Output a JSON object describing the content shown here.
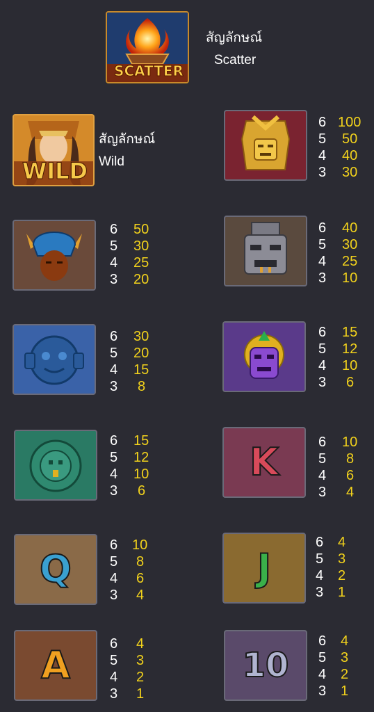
{
  "scatter": {
    "label_th": "สัญลักษณ์",
    "label_en": "Scatter",
    "badge": "SCATTER"
  },
  "wild": {
    "label_th": "สัญลักษณ์",
    "label_en": "Wild",
    "badge": "WILD"
  },
  "paytable": [
    {
      "symbol": "gold-mask-icon",
      "rows": [
        {
          "count": "6",
          "mult": "100"
        },
        {
          "count": "5",
          "mult": "50"
        },
        {
          "count": "4",
          "mult": "40"
        },
        {
          "count": "3",
          "mult": "30"
        }
      ]
    },
    {
      "symbol": "blue-headdress-icon",
      "rows": [
        {
          "count": "6",
          "mult": "50"
        },
        {
          "count": "5",
          "mult": "30"
        },
        {
          "count": "4",
          "mult": "25"
        },
        {
          "count": "3",
          "mult": "20"
        }
      ]
    },
    {
      "symbol": "stone-mask-icon",
      "rows": [
        {
          "count": "6",
          "mult": "40"
        },
        {
          "count": "5",
          "mult": "30"
        },
        {
          "count": "4",
          "mult": "25"
        },
        {
          "count": "3",
          "mult": "10"
        }
      ]
    },
    {
      "symbol": "blue-medallion-icon",
      "rows": [
        {
          "count": "6",
          "mult": "30"
        },
        {
          "count": "5",
          "mult": "20"
        },
        {
          "count": "4",
          "mult": "15"
        },
        {
          "count": "3",
          "mult": "8"
        }
      ]
    },
    {
      "symbol": "purple-mask-icon",
      "rows": [
        {
          "count": "6",
          "mult": "15"
        },
        {
          "count": "5",
          "mult": "12"
        },
        {
          "count": "4",
          "mult": "10"
        },
        {
          "count": "3",
          "mult": "6"
        }
      ]
    },
    {
      "symbol": "green-sun-disc-icon",
      "rows": [
        {
          "count": "6",
          "mult": "15"
        },
        {
          "count": "5",
          "mult": "12"
        },
        {
          "count": "4",
          "mult": "10"
        },
        {
          "count": "3",
          "mult": "6"
        }
      ]
    },
    {
      "symbol": "k-letter-icon",
      "letter": "K",
      "rows": [
        {
          "count": "6",
          "mult": "10"
        },
        {
          "count": "5",
          "mult": "8"
        },
        {
          "count": "4",
          "mult": "6"
        },
        {
          "count": "3",
          "mult": "4"
        }
      ]
    },
    {
      "symbol": "q-letter-icon",
      "letter": "Q",
      "rows": [
        {
          "count": "6",
          "mult": "10"
        },
        {
          "count": "5",
          "mult": "8"
        },
        {
          "count": "4",
          "mult": "6"
        },
        {
          "count": "3",
          "mult": "4"
        }
      ]
    },
    {
      "symbol": "j-letter-icon",
      "letter": "J",
      "rows": [
        {
          "count": "6",
          "mult": "4"
        },
        {
          "count": "5",
          "mult": "3"
        },
        {
          "count": "4",
          "mult": "2"
        },
        {
          "count": "3",
          "mult": "1"
        }
      ]
    },
    {
      "symbol": "a-letter-icon",
      "letter": "A",
      "rows": [
        {
          "count": "6",
          "mult": "4"
        },
        {
          "count": "5",
          "mult": "3"
        },
        {
          "count": "4",
          "mult": "2"
        },
        {
          "count": "3",
          "mult": "1"
        }
      ]
    },
    {
      "symbol": "ten-letter-icon",
      "letter": "10",
      "rows": [
        {
          "count": "6",
          "mult": "4"
        },
        {
          "count": "5",
          "mult": "3"
        },
        {
          "count": "4",
          "mult": "2"
        },
        {
          "count": "3",
          "mult": "1"
        }
      ]
    }
  ]
}
